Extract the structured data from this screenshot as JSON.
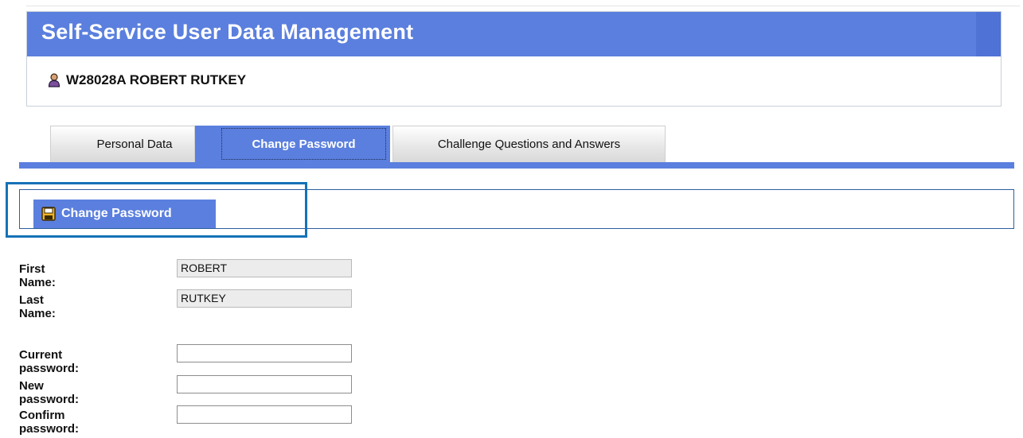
{
  "header": {
    "title": "Self-Service User Data Management",
    "user_icon": "user-icon",
    "user": "W28028A ROBERT RUTKEY",
    "brand_color": "#5b7fde"
  },
  "tabs": [
    {
      "label": "Personal Data",
      "active": false
    },
    {
      "label": "Change Password",
      "active": true
    },
    {
      "label": "Challenge Questions and Answers",
      "active": false
    }
  ],
  "toolbar": {
    "button_icon": "save-icon",
    "button_label": "Change Password",
    "highlight_color": "#1572b7"
  },
  "form": {
    "first_name_label": "First Name:",
    "first_name_value": "ROBERT",
    "last_name_label": "Last Name:",
    "last_name_value": "RUTKEY",
    "current_password_label": "Current password:",
    "current_password_value": "",
    "new_password_label": "New password:",
    "new_password_value": "",
    "confirm_password_label": "Confirm password:",
    "confirm_password_value": ""
  }
}
